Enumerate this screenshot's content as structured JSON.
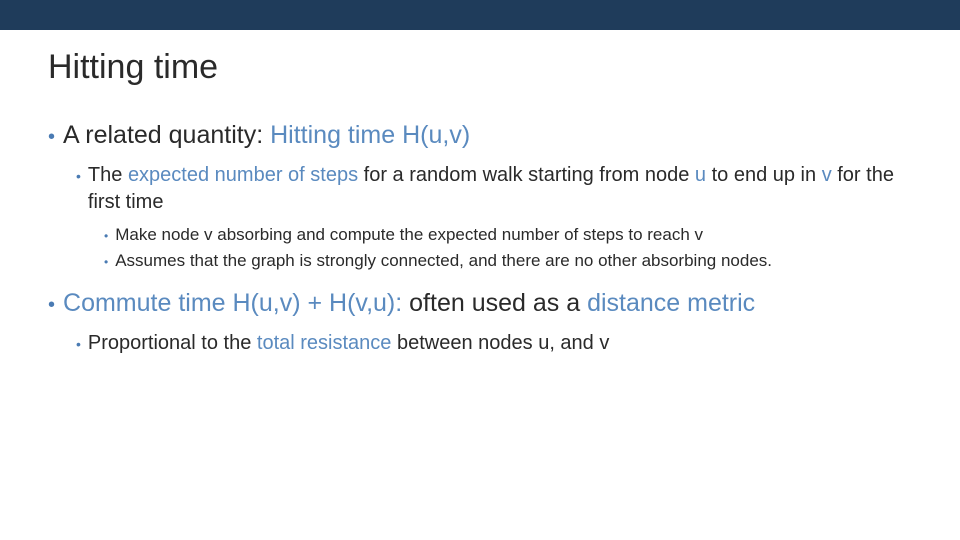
{
  "title": "Hitting time",
  "b1a": {
    "pre": "A related quantity: ",
    "hl": "Hitting time H(u,v)"
  },
  "b2a": {
    "t1": "The ",
    "t2": "expected number of steps",
    "t3": " for a random walk starting from node ",
    "t4": "u",
    "t5": " to end up in ",
    "t6": "v",
    "t7": " for the first time"
  },
  "b3a": "Make node v absorbing and compute the expected number of steps to reach v",
  "b3b": "Assumes that the graph is strongly connected, and there are no other absorbing nodes.",
  "b1b": {
    "t1": "Commute time H(u,v) + H(v,u):",
    "t2": " often used as a ",
    "t3": "distance metric"
  },
  "b2b": {
    "t1": "Proportional to the ",
    "t2": "total resistance",
    "t3": " between nodes u, and v"
  }
}
